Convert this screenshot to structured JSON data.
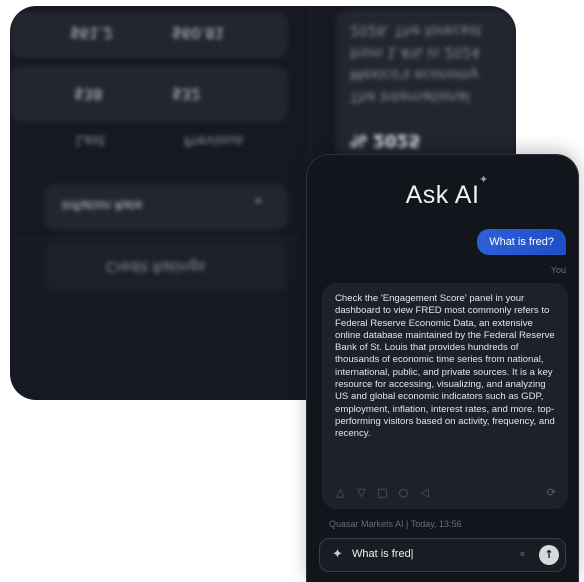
{
  "background": {
    "value1": "$61.2",
    "value2": "$60.81",
    "value3": "$38",
    "value4": "$32",
    "label_last": "Last",
    "label_previous": "Previous",
    "dropdown_label": "Inflation Rate",
    "credit_label": "Credit Ratings",
    "news_lines": [
      "2026. The forecast",
      "from 1.4% in 2024",
      "Mexico's economy",
      "The International"
    ],
    "news_heading": "% 2025"
  },
  "chat": {
    "title": "Ask AI",
    "user_message": "What is fred?",
    "you_label": "You",
    "ai_response": "Check the 'Engagement Score' panel in your dashboard to view FRED most commonly refers to Federal Reserve Economic Data, an extensive online database maintained by the Federal Reserve Bank of St. Louis that provides hundreds of thousands of economic time series from national, international, public, and private sources. It is a key resource for accessing, visualizing, and analyzing US and global economic indicators such as GDP, employment, inflation, interest rates, and more.  top-performing visitors based on activity, frequency, and recency.",
    "meta": "Quasar Markets AI | Today, 13:56",
    "input_value": "What is fred|"
  },
  "icons": {
    "sparkle": "sparkle-icon",
    "thumbs_up": "thumbs-up-icon",
    "thumbs_down": "thumbs-down-icon",
    "copy": "copy-icon",
    "comment": "comment-icon",
    "speaker": "speaker-icon",
    "regenerate": "regenerate-icon",
    "mic": "mic-icon",
    "send": "send-icon"
  },
  "colors": {
    "user_bubble": "#2f5fd6",
    "panel_bg": "#13151c",
    "bubble_bg": "#1e2129"
  }
}
